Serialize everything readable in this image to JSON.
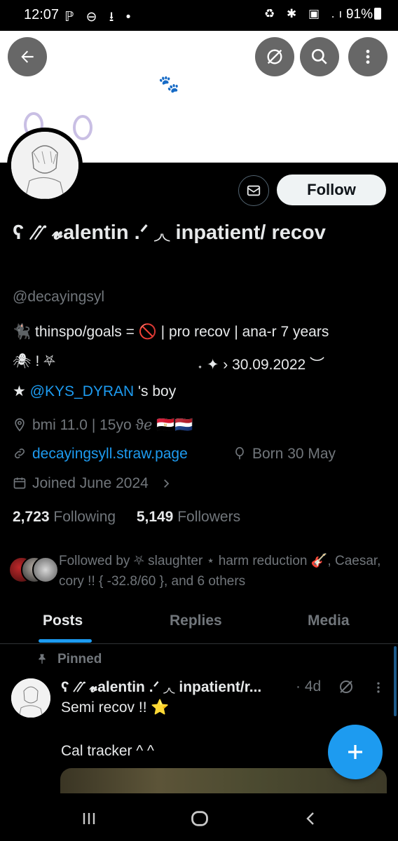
{
  "status_bar": {
    "time": "12:07",
    "left_icons": "ℙ ⊖ ⭳ •",
    "right_icons": "♻ ✱ ▣ .ıl",
    "battery": "91%"
  },
  "profile": {
    "display_name": "ʕ ⳼ 𝓿alentin .ᐟ ◞◟ inpatient/ recov",
    "handle": "@decayingsyl",
    "follow_label": "Follow",
    "bio_line1": "🐈‍⬛ thinspo/goals = 🚫 | pro recov | ana-r 7 years",
    "bio_line2_left": "🕷 ! ⛧",
    "bio_line2_right": "˖  ✦ › 30.09.2022 ︶",
    "bio_line3_prefix": "★ ",
    "bio_line3_mention": "@KYS_DYRAN",
    "bio_line3_suffix": " 's boy",
    "location": "bmi 11.0 | 15yo ϑℯ 🇪🇬🇳🇱",
    "website": "decayingsyll.straw.page",
    "birthday": "Born 30 May",
    "joined": "Joined June 2024",
    "following_count": "2,723",
    "following_label": "Following",
    "followers_count": "5,149",
    "followers_label": "Followers",
    "followed_by": "Followed by ⛧ slaughter ⋆ harm reduction 🎸, Caesar, cory !! { -32.8/60 }, and 6 others"
  },
  "tabs": [
    {
      "label": "Posts",
      "active": true
    },
    {
      "label": "Replies",
      "active": false
    },
    {
      "label": "Media",
      "active": false
    }
  ],
  "pinned_post": {
    "pinned_label": "Pinned",
    "author": "ʕ ⳼ 𝓿alentin .ᐟ ◞◟ inpatient/r...",
    "time": "· 4d",
    "line1": "Semi recov !! ⭐",
    "line2": "Cal tracker ^ ^"
  },
  "colors": {
    "accent": "#1d9bf0",
    "background": "#000000",
    "text": "#e7e9ea",
    "muted": "#71767b"
  }
}
